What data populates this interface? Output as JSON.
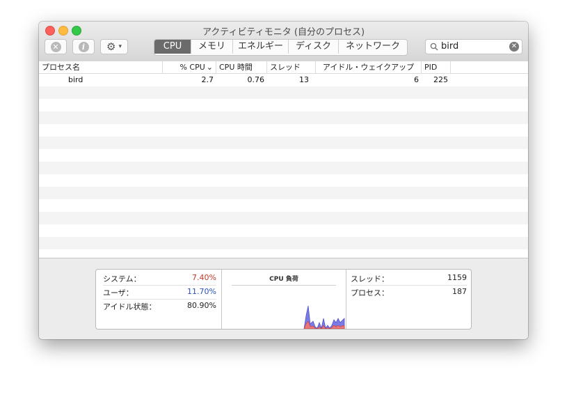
{
  "window": {
    "title": "アクティビティモニタ (自分のプロセス)"
  },
  "toolbar": {
    "stop_icon": "x-circle-icon",
    "info_icon": "info-icon",
    "gear_icon": "gear-icon",
    "tabs": [
      {
        "label": "CPU",
        "active": true
      },
      {
        "label": "メモリ",
        "active": false
      },
      {
        "label": "エネルギー",
        "active": false
      },
      {
        "label": "ディスク",
        "active": false
      },
      {
        "label": "ネットワーク",
        "active": false
      }
    ],
    "search": {
      "value": "bird"
    }
  },
  "table": {
    "columns": [
      "プロセス名",
      "% CPU",
      "CPU 時間",
      "スレッド",
      "アイドル・ウェイクアップ",
      "PID"
    ],
    "sort_indicator": "⌄",
    "rows": [
      {
        "name": "bird",
        "cpu": "2.7",
        "cpu_time": "0.76",
        "threads": "13",
        "idle_wakeups": "6",
        "pid": "225"
      }
    ]
  },
  "summary": {
    "system_label": "システム：",
    "system_value": "7.40%",
    "user_label": "ユーザ：",
    "user_value": "11.70%",
    "idle_label": "アイドル状態：",
    "idle_value": "80.90%",
    "graph_title": "CPU 負荷",
    "threads_label": "スレッド：",
    "threads_value": "1159",
    "processes_label": "プロセス：",
    "processes_value": "187",
    "colors": {
      "system": "#c0392b",
      "user": "#2a4fb5",
      "graph_user": "#7b7be6",
      "graph_system": "#e87878"
    }
  }
}
